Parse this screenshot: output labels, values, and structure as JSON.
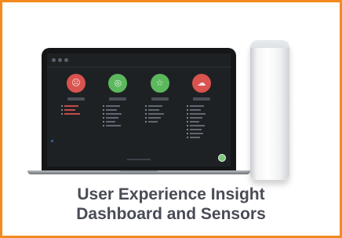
{
  "card": {
    "border_color": "#f28a1e",
    "caption_line1": "User Experience Insight",
    "caption_line2": "Dashboard and Sensors"
  },
  "dashboard": {
    "categories": [
      {
        "color": "#d9534f",
        "icon": "fail-face-icon",
        "items": [
          3,
          3
        ]
      },
      {
        "color": "#5cb85c",
        "icon": "wifi-icon",
        "items": [
          6,
          0
        ]
      },
      {
        "color": "#5cb85c",
        "icon": "star-icon",
        "items": [
          5,
          0
        ]
      },
      {
        "color": "#d9534f",
        "icon": "cloud-icon",
        "items": [
          9,
          0
        ]
      }
    ]
  }
}
